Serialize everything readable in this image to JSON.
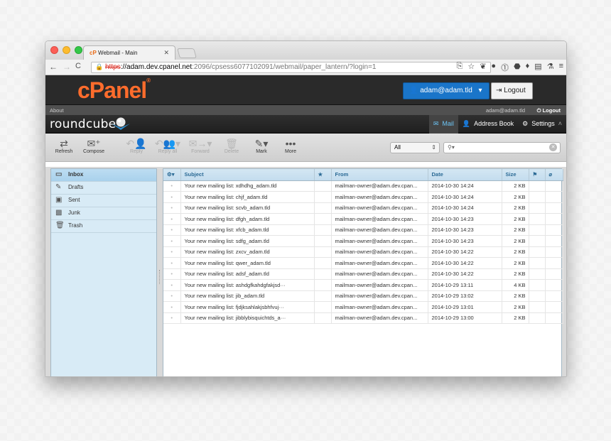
{
  "browser": {
    "tab_title": "Webmail - Main",
    "tab_favicon": "cP",
    "url_scheme": "https",
    "url_host": "://adam.dev.cpanel.net",
    "url_path": ":2096/cpsess6077102091/webmail/paper_lantern/?login=1"
  },
  "cpanel": {
    "logo": "cPanel",
    "user_button": "adam@adam.tld",
    "logout_button": "Logout"
  },
  "roundcube": {
    "about": "About",
    "user": "adam@adam.tld",
    "logout": "Logout",
    "logo": "roundcube",
    "nav": {
      "mail": "Mail",
      "address_book": "Address Book",
      "settings": "Settings"
    }
  },
  "toolbar": {
    "refresh": "Refresh",
    "compose": "Compose",
    "reply": "Reply",
    "reply_all": "Reply all",
    "forward": "Forward",
    "delete": "Delete",
    "mark": "Mark",
    "more": "More",
    "filter": "All",
    "search_placeholder": ""
  },
  "folders": [
    {
      "label": "Inbox",
      "icon": "inbox-icon",
      "glyph": "▭",
      "selected": true
    },
    {
      "label": "Drafts",
      "icon": "pencil-icon",
      "glyph": "✎",
      "selected": false
    },
    {
      "label": "Sent",
      "icon": "sent-icon",
      "glyph": "▣",
      "selected": false
    },
    {
      "label": "Junk",
      "icon": "junk-icon",
      "glyph": "▩",
      "selected": false
    },
    {
      "label": "Trash",
      "icon": "trash-icon",
      "glyph": "🗑",
      "selected": false
    }
  ],
  "columns": {
    "subject": "Subject",
    "from": "From",
    "date": "Date",
    "size": "Size"
  },
  "messages": [
    {
      "subject": "Your new mailing list: xdhdhg_adam.tld",
      "from": "mailman-owner@adam.dev.cpan...",
      "date": "2014-10-30 14:24",
      "size": "2 KB"
    },
    {
      "subject": "Your new mailing list: chjf_adam.tld",
      "from": "mailman-owner@adam.dev.cpan...",
      "date": "2014-10-30 14:24",
      "size": "2 KB"
    },
    {
      "subject": "Your new mailing list: scvb_adam.tld",
      "from": "mailman-owner@adam.dev.cpan...",
      "date": "2014-10-30 14:24",
      "size": "2 KB"
    },
    {
      "subject": "Your new mailing list: dfgh_adam.tld",
      "from": "mailman-owner@adam.dev.cpan...",
      "date": "2014-10-30 14:23",
      "size": "2 KB"
    },
    {
      "subject": "Your new mailing list: xfcb_adam.tld",
      "from": "mailman-owner@adam.dev.cpan...",
      "date": "2014-10-30 14:23",
      "size": "2 KB"
    },
    {
      "subject": "Your new mailing list: sdfg_adam.tld",
      "from": "mailman-owner@adam.dev.cpan...",
      "date": "2014-10-30 14:23",
      "size": "2 KB"
    },
    {
      "subject": "Your new mailing list: zxcv_adam.tld",
      "from": "mailman-owner@adam.dev.cpan...",
      "date": "2014-10-30 14:22",
      "size": "2 KB"
    },
    {
      "subject": "Your new mailing list: qwer_adam.tld",
      "from": "mailman-owner@adam.dev.cpan...",
      "date": "2014-10-30 14:22",
      "size": "2 KB"
    },
    {
      "subject": "Your new mailing list: adsf_adam.tld",
      "from": "mailman-owner@adam.dev.cpan...",
      "date": "2014-10-30 14:22",
      "size": "2 KB"
    },
    {
      "subject": "Your new mailing list: ashdgfkahdgfakjsd···",
      "from": "mailman-owner@adam.dev.cpan...",
      "date": "2014-10-29 13:11",
      "size": "4 KB"
    },
    {
      "subject": "Your new mailing list: jib_adam.tld",
      "from": "mailman-owner@adam.dev.cpan...",
      "date": "2014-10-29 13:02",
      "size": "2 KB"
    },
    {
      "subject": "Your new mailing list: fjdjksahlakjsbhfvuj···",
      "from": "mailman-owner@adam.dev.cpan...",
      "date": "2014-10-29 13:01",
      "size": "2 KB"
    },
    {
      "subject": "Your new mailing list: jibblybisquichtds_a···",
      "from": "mailman-owner@adam.dev.cpan...",
      "date": "2014-10-29 13:00",
      "size": "2 KB"
    }
  ],
  "colors": {
    "cpanel_orange": "#ff6c2c",
    "accent_blue": "#1a75c9",
    "mail_nav": "#6cc3f3"
  }
}
